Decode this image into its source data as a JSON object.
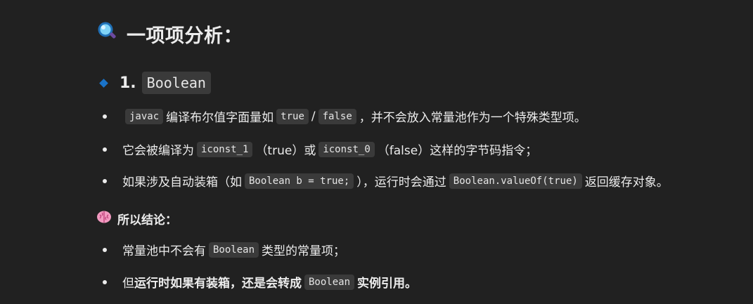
{
  "section": {
    "icon": "magnifier-icon",
    "title": "一项项分析："
  },
  "item": {
    "icon": "diamond-icon",
    "number": "1.",
    "code": "Boolean"
  },
  "bullets": {
    "b1": {
      "code1": "javac",
      "text1": "编译布尔值字面量如",
      "code2": "true",
      "slash": "/",
      "code3": "false",
      "text2": "，并不会放入常量池作为一个特殊类型项。"
    },
    "b2": {
      "text1": "它会被编译为",
      "code1": "iconst_1",
      "paren1": "（true）或",
      "code2": "iconst_0",
      "paren2": "（false）这样的字节码指令；"
    },
    "b3": {
      "text1": "如果涉及自动装箱（如",
      "code1": "Boolean b = true;",
      "text2": "），运行时会通过",
      "code2": "Boolean.valueOf(true)",
      "text3": "返回缓存对象。"
    }
  },
  "conclusion": {
    "icon": "brain-icon",
    "label": "所以结论：",
    "b1": {
      "text1": "常量池中不会有",
      "code1": "Boolean",
      "text2": "类型的常量项；"
    },
    "b2": {
      "text1": "但",
      "bold1": "运行时如果有装箱，还是会转成",
      "code1": "Boolean",
      "bold2": "实例引用。"
    }
  }
}
